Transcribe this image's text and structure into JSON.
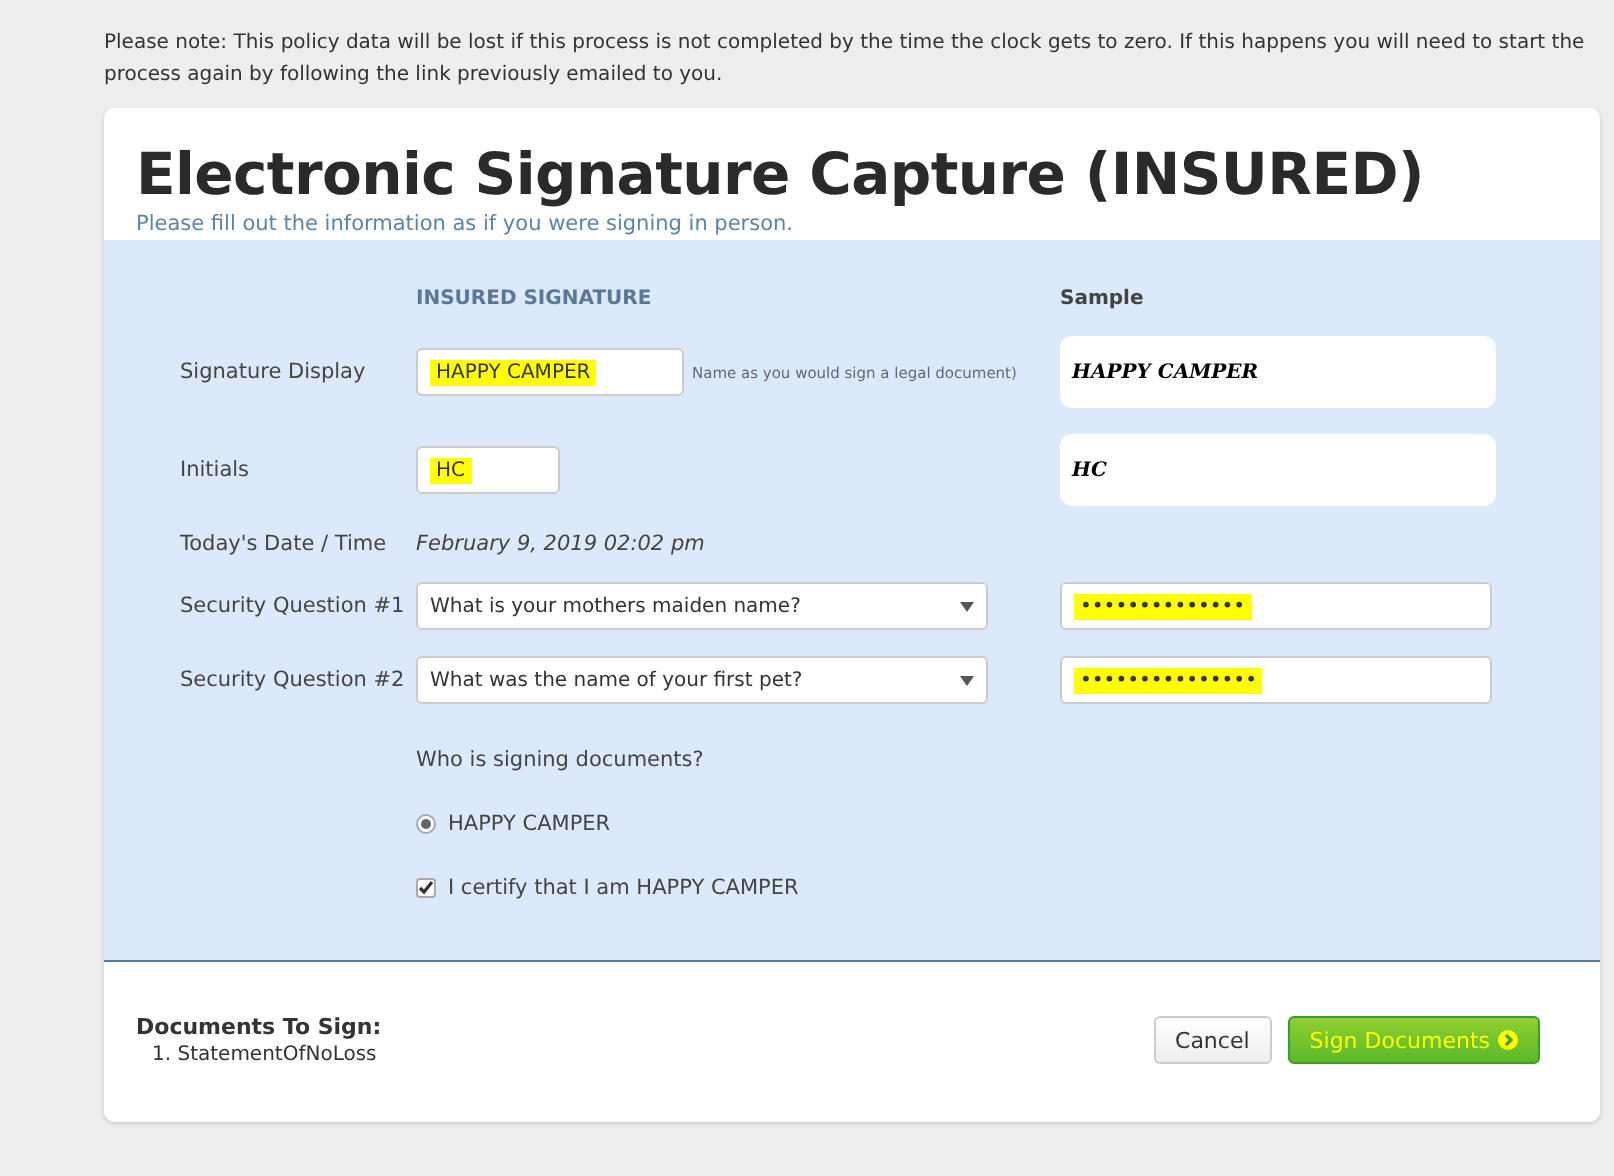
{
  "notice": "Please note: This policy data will be lost if this process is not completed by the time the clock gets to zero. If this happens you will need to start the process again by following the link previously emailed to you.",
  "title": "Electronic Signature Capture (INSURED)",
  "subtitle": "Please fill out the information as if you were signing in person.",
  "column_headers": {
    "input": "INSURED SIGNATURE",
    "sample": "Sample"
  },
  "rows": [
    {
      "kind": "text",
      "label": "Signature Display",
      "value": "HAPPY CAMPER",
      "highlighted": true,
      "hint": "Name as you would sign a legal document)",
      "sample": "HAPPY CAMPER"
    },
    {
      "kind": "text",
      "label": "Initials",
      "value": "HC",
      "highlighted": true,
      "sample": "HC"
    },
    {
      "kind": "static",
      "label": "Today's Date / Time",
      "value": "February 9, 2019 02:02 pm"
    },
    {
      "kind": "select",
      "label": "Security Question #1",
      "value": "What is your mothers maiden name?",
      "answer": "••••••••••••••",
      "highlighted": true
    },
    {
      "kind": "select",
      "label": "Security Question #2",
      "value": "What was the name of your first pet?",
      "answer": "•••••••••••••••",
      "highlighted": true
    }
  ],
  "signer_prompt": "Who is signing documents?",
  "signers": [
    {
      "label": "HAPPY CAMPER",
      "selected": true
    }
  ],
  "certify": {
    "label": "I certify that I am HAPPY CAMPER",
    "checked": true
  },
  "documents": {
    "heading": "Documents To Sign:",
    "items": [
      "1. StatementOfNoLoss"
    ]
  },
  "buttons": [
    {
      "kind": "default",
      "label": "Cancel"
    },
    {
      "kind": "primary",
      "label": "Sign Documents",
      "highlighted": true
    }
  ]
}
